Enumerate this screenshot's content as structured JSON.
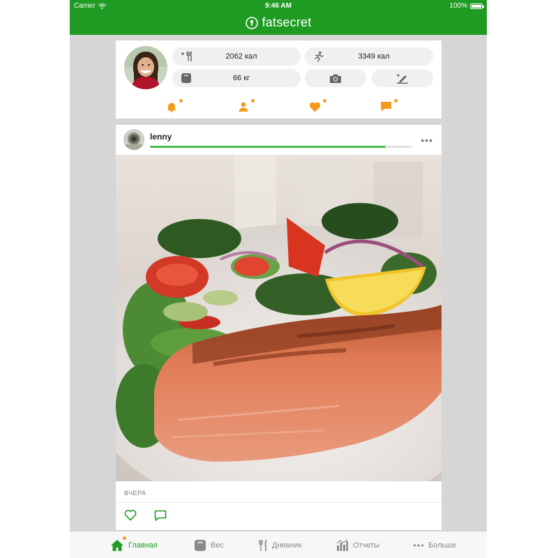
{
  "status_bar": {
    "carrier": "Carrier",
    "time": "9:46 AM",
    "battery": "100%"
  },
  "header": {
    "brand": "fatsecret"
  },
  "profile": {
    "stats": {
      "food": "2062 кал",
      "exercise": "3349 кал",
      "weight": "66 кг"
    },
    "icons": {
      "food": "fork-knife-icon",
      "exercise": "runner-icon",
      "weight": "scale-icon",
      "camera": "camera-icon",
      "edit": "pencil-icon"
    },
    "notifications": [
      "bell-icon",
      "person-icon",
      "heart-icon",
      "chat-icon"
    ]
  },
  "post": {
    "username": "lenny",
    "progress": 0.9,
    "more": "•••",
    "time": "ВЧЕРА",
    "actions": [
      "heart-outline-icon",
      "comment-icon"
    ]
  },
  "tabs": [
    {
      "label": "Главная",
      "icon": "home-icon",
      "active": true
    },
    {
      "label": "Вес",
      "icon": "scale-icon",
      "active": false
    },
    {
      "label": "Дневник",
      "icon": "fork-knife-icon",
      "active": false
    },
    {
      "label": "Отчеты",
      "icon": "bar-chart-icon",
      "active": false
    },
    {
      "label": "Больше",
      "icon": "more-dots-icon",
      "active": false
    }
  ],
  "colors": {
    "brand_green": "#1f9b23",
    "accent_orange": "#f39a1c",
    "progress_green": "#4cbb48"
  }
}
